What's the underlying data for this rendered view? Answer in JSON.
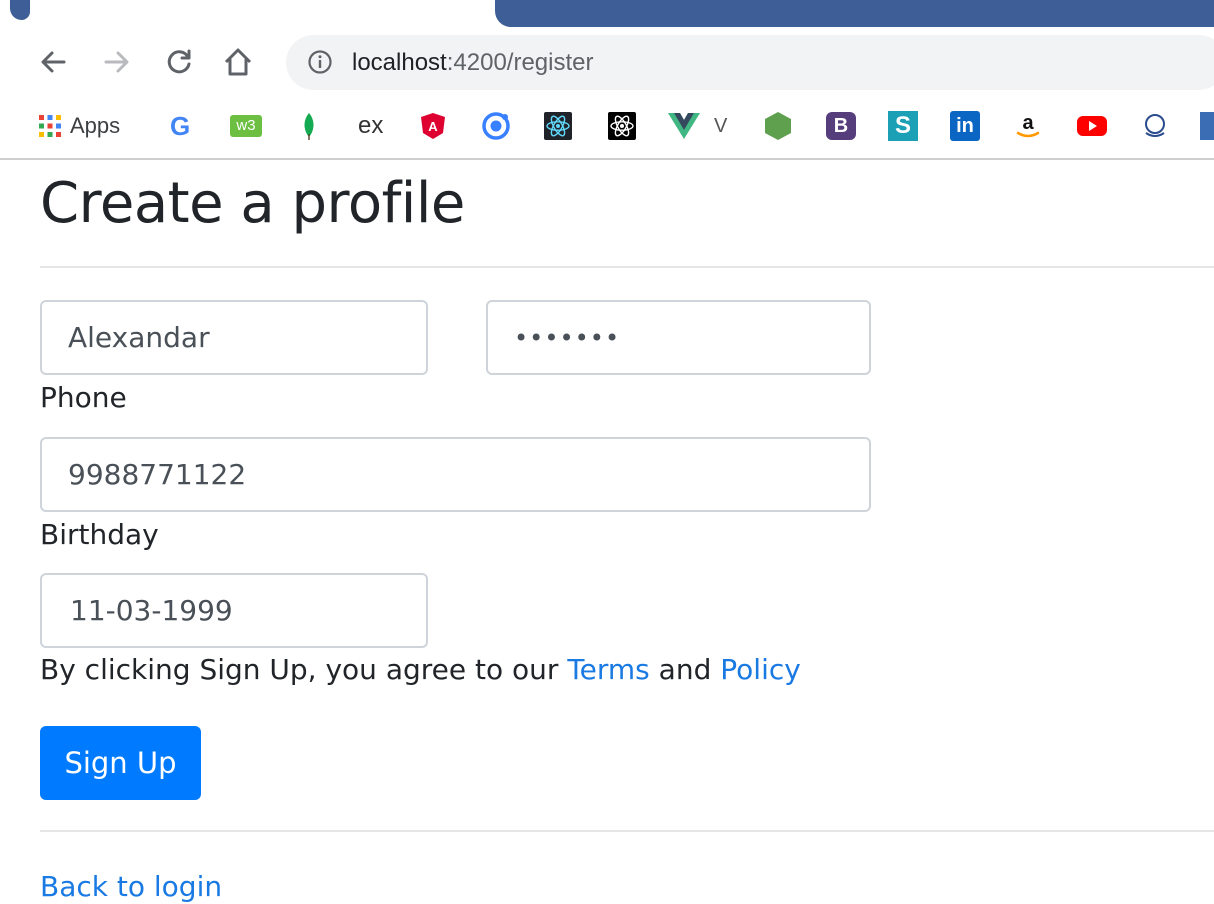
{
  "browser": {
    "url_host": "localhost",
    "url_rest": ":4200/register",
    "bookmarks": [
      {
        "icon": "apps-grid-icon",
        "label": "Apps"
      },
      {
        "icon": "google-icon",
        "label": "G"
      },
      {
        "icon": "w3schools-icon",
        "label": "w3"
      },
      {
        "icon": "mongodb-leaf-icon",
        "label": ""
      },
      {
        "icon": "express-icon",
        "label": "ex"
      },
      {
        "icon": "angular-icon",
        "label": "A"
      },
      {
        "icon": "ionic-icon",
        "label": ""
      },
      {
        "icon": "react-icon",
        "label": ""
      },
      {
        "icon": "react-native-icon",
        "label": ""
      },
      {
        "icon": "vue-icon",
        "label": "V"
      },
      {
        "icon": "nodejs-icon",
        "label": ""
      },
      {
        "icon": "bootstrap-icon",
        "label": "B"
      },
      {
        "icon": "stackblitz-icon",
        "label": "S"
      },
      {
        "icon": "linkedin-icon",
        "label": "in"
      },
      {
        "icon": "amazon-icon",
        "label": "a"
      },
      {
        "icon": "youtube-icon",
        "label": ""
      },
      {
        "icon": "bi-icon",
        "label": ""
      }
    ],
    "colors": {
      "tab_bar": "#3d5e96",
      "omnibox": "#f1f3f4"
    }
  },
  "page": {
    "title": "Create a profile",
    "name_value": "Alexandar",
    "password_value": "•••••••",
    "phone_label": "Phone",
    "phone_value": "9988771122",
    "birthday_label": "Birthday",
    "birthday_value": "11-03-1999",
    "agree_text": "By clicking Sign Up, you agree to our ",
    "terms_link": "Terms",
    "and_text": " and ",
    "policy_link": "Policy",
    "signup_button": "Sign Up",
    "back_link": "Back to login"
  },
  "colors": {
    "primary": "#007bff",
    "link": "#1a7ae3",
    "text": "#212529"
  }
}
